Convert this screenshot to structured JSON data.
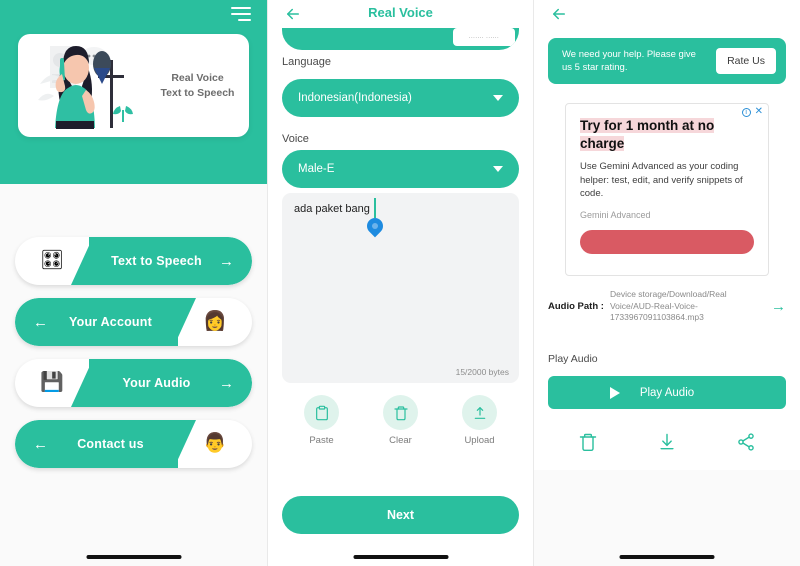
{
  "app": {
    "accent": "#2ABF9E",
    "ad_accent": "#d95a63",
    "handle_color": "#1E8BE0"
  },
  "left": {
    "menu_icon": "hamburger-icon",
    "hero": {
      "title_line1": "Real Voice",
      "title_line2": "Text to Speech",
      "illustration": "woman-with-headphones-microphone-illustration"
    },
    "menu_items": [
      {
        "label": "Text to Speech",
        "direction": "right",
        "avatar": "🎛",
        "arrow": "→",
        "arrow_icon": "arrow-right-icon"
      },
      {
        "label": "Your Account",
        "direction": "left",
        "avatar": "👩",
        "arrow": "←",
        "arrow_icon": "arrow-left-icon"
      },
      {
        "label": "Your Audio",
        "direction": "right",
        "avatar": "💾",
        "arrow": "→",
        "arrow_icon": "arrow-right-icon"
      },
      {
        "label": "Contact us",
        "direction": "left",
        "avatar": "👨",
        "arrow": "←",
        "arrow_icon": "arrow-left-icon"
      }
    ]
  },
  "middle": {
    "back_icon": "arrow-left-icon",
    "title": "Real Voice",
    "cut_badge": "....... ......",
    "language_label": "Language",
    "language_value": "Indonesian(Indonesia)",
    "voice_label": "Voice",
    "voice_value": "Male-E",
    "text_value": "ada paket bang",
    "byte_counter": "15/2000 bytes",
    "actions": [
      {
        "label": "Paste",
        "icon": "clipboard-icon"
      },
      {
        "label": "Clear",
        "icon": "trash-icon"
      },
      {
        "label": "Upload",
        "icon": "upload-icon"
      }
    ],
    "next_label": "Next"
  },
  "right": {
    "back_icon": "arrow-left-icon",
    "rate_message": "We need your help. Please give us 5 star rating.",
    "rate_button": "Rate Us",
    "ad": {
      "info_icon": "info-icon",
      "close_icon": "close-icon",
      "headline": "Try for 1 month at no charge",
      "body": "Use Gemini Advanced as your coding helper: test, edit, and verify snippets of code.",
      "brand": "Gemini Advanced",
      "cta_label": ""
    },
    "audio_path_label": "Audio Path :",
    "audio_path_value": "Device storage/Download/Real Voice/AUD-Real-Voice-1733967091103864.mp3",
    "audio_path_arrow": "→",
    "play_section_label": "Play Audio",
    "play_button_label": "Play Audio",
    "bottom_icons": [
      {
        "icon": "delete-icon"
      },
      {
        "icon": "download-icon"
      },
      {
        "icon": "share-icon"
      }
    ]
  }
}
